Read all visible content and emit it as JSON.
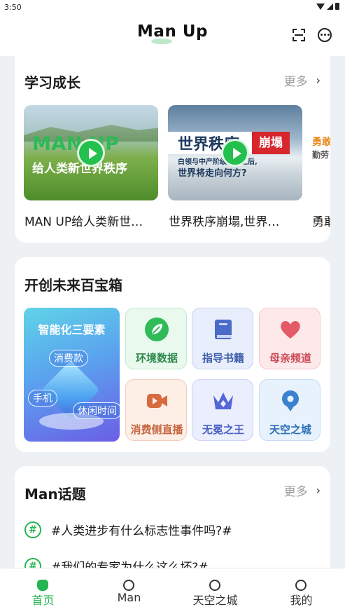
{
  "status_bar": {
    "time": "3:50"
  },
  "app_bar": {
    "logo_text": "Man Up"
  },
  "learning": {
    "title": "学习成长",
    "more_label": "更多",
    "videos": [
      {
        "thumb_line1": "MAN UP",
        "thumb_line2": "给人类新世界秩序",
        "caption": "MAN UP给人类新世…"
      },
      {
        "thumb_line1": "世界秩序",
        "thumb_tag": "崩塌",
        "thumb_line2": "白领与中产阶级破产之后,",
        "thumb_line3": "世界将走向何方?",
        "caption": "世界秩序崩塌,世界…"
      },
      {
        "thumb_line1": "勇敢",
        "thumb_line2": "勤劳",
        "caption": "勇敢"
      }
    ]
  },
  "treasure": {
    "title": "开创未来百宝箱",
    "feature": {
      "title": "智能化三要素",
      "chips": [
        "消费款",
        "手机",
        "休闲时间"
      ]
    },
    "tiles": [
      {
        "label": "环境数据",
        "icon": "leaf-icon"
      },
      {
        "label": "指导书籍",
        "icon": "book-icon"
      },
      {
        "label": "母亲频道",
        "icon": "heart-icon"
      },
      {
        "label": "消费侧直播",
        "icon": "video-camera-icon"
      },
      {
        "label": "无冕之王",
        "icon": "crown-icon"
      },
      {
        "label": "天空之城",
        "icon": "location-pin-icon"
      }
    ]
  },
  "topics": {
    "title": "Man话题",
    "more_label": "更多",
    "items": [
      "#人类进步有什么标志性事件吗?#",
      "#我们的专家为什么这么坏?#"
    ]
  },
  "bottom_nav": {
    "items": [
      {
        "label": "首页",
        "active": true
      },
      {
        "label": "Man",
        "active": false
      },
      {
        "label": "天空之城",
        "active": false
      },
      {
        "label": "我的",
        "active": false
      }
    ]
  },
  "colors": {
    "accent": "#23b54f",
    "background": "#eef1f3"
  }
}
